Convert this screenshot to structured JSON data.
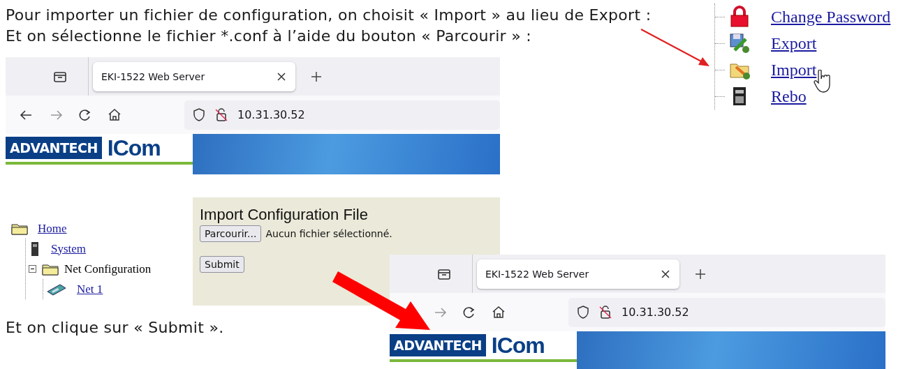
{
  "instructions": [
    "Pour importer un fichier de configuration, on choisit « Import » au lieu de Export :",
    "Et on sélectionne le fichier *.conf à l’aide du bouton « Parcourir » :"
  ],
  "menu_tree": {
    "items": [
      {
        "label": "Change Password",
        "kind": "lock"
      },
      {
        "label": "Export",
        "kind": "export"
      },
      {
        "label": "Import",
        "kind": "import"
      },
      {
        "label": "Rebo",
        "kind": "reboot"
      }
    ]
  },
  "browser_top": {
    "tab_title": "EKI-1522 Web Server",
    "url": "10.31.30.52",
    "logo_brand": "ADVANTECH",
    "logo_product": "ICom"
  },
  "import_page": {
    "tree": [
      {
        "label": "Home",
        "link": true,
        "kind": "folder",
        "children": [
          {
            "label": "System",
            "link": true,
            "kind": "device"
          },
          {
            "label": "Net Configuration",
            "link": false,
            "kind": "folder",
            "expanded": true,
            "children": [
              {
                "label": "Net 1",
                "link": true,
                "kind": "network"
              }
            ]
          }
        ]
      }
    ],
    "form": {
      "title": "Import Configuration File",
      "browse_button": "Parcourir...",
      "file_status": "Aucun fichier sélectionné.",
      "submit_button": "Submit"
    }
  },
  "browser_bottom": {
    "tab_title": "EKI-1522 Web Server",
    "url": "10.31.30.52",
    "logo_brand": "ADVANTECH",
    "logo_product": "ICom"
  },
  "closing": "Et on clique sur « Submit »."
}
